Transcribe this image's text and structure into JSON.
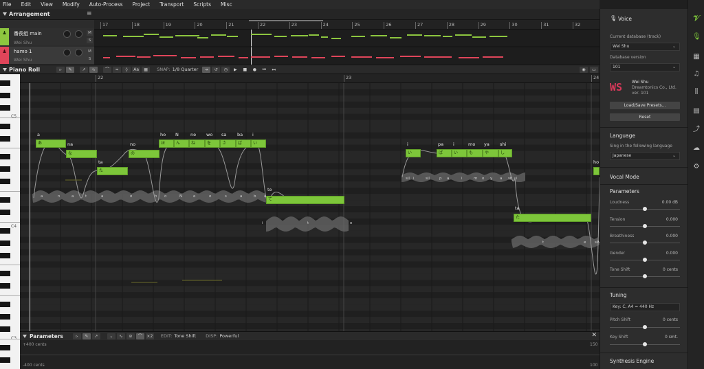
{
  "menu": [
    "File",
    "Edit",
    "View",
    "Modify",
    "Auto-Process",
    "Project",
    "Transport",
    "Scripts",
    "Misc"
  ],
  "arrangement": {
    "title": "Arrangement",
    "tracks": [
      {
        "name": "番長组 main",
        "voice": "Wei Shu",
        "color": "#8dc63f"
      },
      {
        "name": "hamo 1",
        "voice": "Wei Shu",
        "color": "#e0455a"
      }
    ],
    "ruler": [
      "17",
      "18",
      "19",
      "20",
      "21",
      "22",
      "23",
      "24",
      "25",
      "26",
      "27",
      "28",
      "29",
      "30",
      "31",
      "32",
      "33"
    ]
  },
  "piano_roll": {
    "title": "Piano Roll",
    "snap_label": "SNAP:",
    "snap_value": "1/8 Quarter",
    "ruler": [
      "22",
      "23",
      "24"
    ],
    "key_labels": [
      "C5",
      "C4",
      "C3"
    ],
    "lyrics_top": [
      "a",
      "na",
      "ta",
      "no",
      "ho",
      "N",
      "ne",
      "wo",
      "sa",
      "ba",
      "i",
      "te",
      "i",
      "pa",
      "i",
      "mo",
      "ya",
      "shi",
      "ta",
      "ho"
    ],
    "notes": [
      "あ",
      "な",
      "た",
      "の",
      "ほ",
      "ん",
      "ね",
      "を",
      "さ",
      "ば",
      "い",
      "て",
      "い",
      "ぱ",
      "い",
      "も",
      "や",
      "し",
      "た"
    ],
    "phonemes": [
      "a",
      "n",
      "a",
      "t",
      "a",
      "o",
      "h",
      "o",
      "N",
      "e",
      "o",
      "s",
      "a",
      "b",
      "a",
      "i",
      "t",
      "e",
      "sil",
      "i",
      "sil",
      "p",
      "a",
      "i",
      "m",
      "o",
      "y",
      "a",
      "sh",
      "i",
      "t",
      "e",
      "sil",
      "N"
    ]
  },
  "parameters_panel": {
    "title": "Parameters",
    "edit_label": "EDIT:",
    "edit_value": "Tone Shift",
    "disp_label": "DISP:",
    "disp_value": "Powerful",
    "top_cents": "+400 cents",
    "bottom_cents": "-400 cents",
    "right_top": "150",
    "right_bottom": "100"
  },
  "voice_panel": {
    "title": "Voice",
    "current_db_label": "Current database (track)",
    "current_db_value": "Wei Shu",
    "db_version_label": "Database version",
    "db_version_value": "101",
    "voice_name": "Wei Shu",
    "company": "Dreamtonics Co., Ltd.",
    "version": "ver. 101",
    "load_save": "Load/Save Presets...",
    "reset": "Reset",
    "language_title": "Language",
    "language_label": "Sing in the following language",
    "language_value": "Japanese",
    "vocal_mode": "Vocal Mode",
    "parameters_title": "Parameters",
    "params": [
      {
        "name": "Loudness",
        "value": "0.00 dB",
        "level": 0.5
      },
      {
        "name": "Tension",
        "value": "0.000",
        "level": 0.5
      },
      {
        "name": "Breathiness",
        "value": "0.000",
        "level": 0.5
      },
      {
        "name": "Gender",
        "value": "0.000",
        "level": 0.5
      },
      {
        "name": "Tone Shift",
        "value": "0 cents",
        "level": 0.5
      }
    ],
    "tuning_title": "Tuning",
    "key_value": "Key: C, A4 = 440 Hz",
    "pitch_shift_label": "Pitch Shift",
    "pitch_shift_value": "0 cents",
    "key_shift_label": "Key Shift",
    "key_shift_value": "0 smt.",
    "synthesis_engine": "Synthesis Engine"
  },
  "colors": {
    "accent": "#7dc63a",
    "track_red": "#e0455a"
  }
}
